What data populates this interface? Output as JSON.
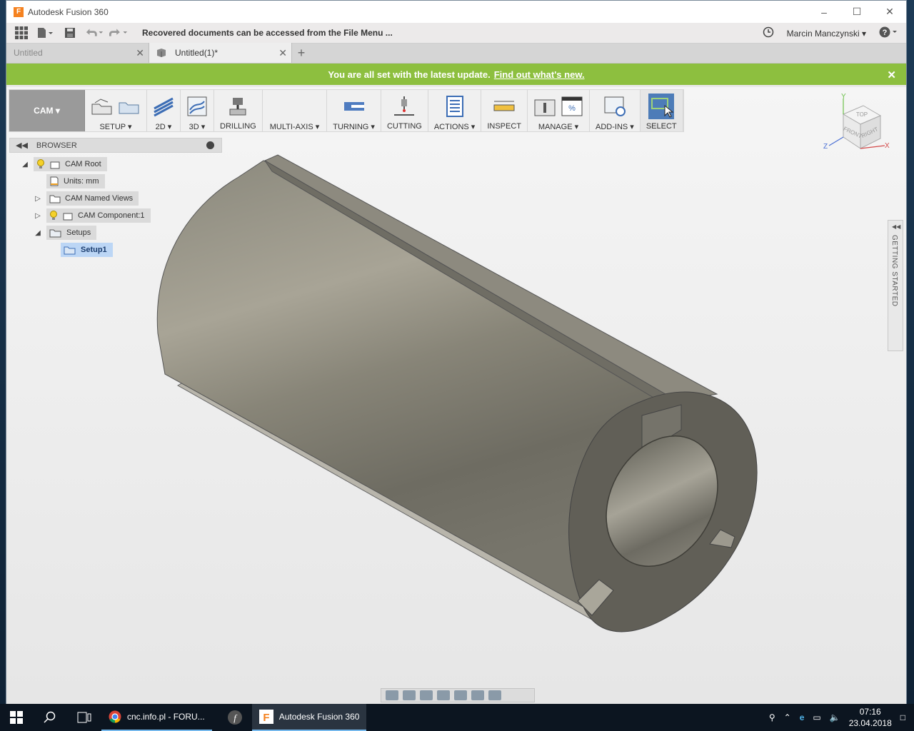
{
  "window": {
    "title": "Autodesk Fusion 360"
  },
  "qat": {
    "recover_message": "Recovered documents can be accessed from the File Menu ...",
    "user": "Marcin Manczynski"
  },
  "tabs": [
    {
      "label": "Untitled",
      "active": false
    },
    {
      "label": "Untitled(1)*",
      "active": true
    }
  ],
  "notice": {
    "text": "You are all set with the latest update.",
    "link": "Find out what's new."
  },
  "toolbar": {
    "workspace": "CAM",
    "groups": [
      {
        "label": "SETUP"
      },
      {
        "label": "2D"
      },
      {
        "label": "3D"
      },
      {
        "label": "DRILLING"
      },
      {
        "label": "MULTI-AXIS"
      },
      {
        "label": "TURNING"
      },
      {
        "label": "CUTTING"
      },
      {
        "label": "ACTIONS"
      },
      {
        "label": "INSPECT"
      },
      {
        "label": "MANAGE"
      },
      {
        "label": "ADD-INS"
      },
      {
        "label": "SELECT"
      }
    ]
  },
  "browser": {
    "title": "BROWSER",
    "items": [
      {
        "label": "CAM Root"
      },
      {
        "label": "Units: mm"
      },
      {
        "label": "CAM Named Views"
      },
      {
        "label": "CAM Component:1"
      },
      {
        "label": "Setups"
      },
      {
        "label": "Setup1"
      }
    ]
  },
  "viewcube": {
    "top": "TOP",
    "front": "FRONT",
    "right": "RIGHT",
    "x": "X",
    "y": "Y",
    "z": "Z"
  },
  "side_panel": {
    "label": "GETTING STARTED"
  },
  "taskbar": {
    "apps": [
      {
        "label": "cnc.info.pl - FORU..."
      },
      {
        "label": "Autodesk Fusion 360"
      }
    ],
    "time": "07:16",
    "date": "23.04.2018"
  },
  "colors": {
    "notice_green": "#8dbf3f",
    "selection_blue": "#bcd6f5",
    "part_gray": "#7f7d72"
  }
}
